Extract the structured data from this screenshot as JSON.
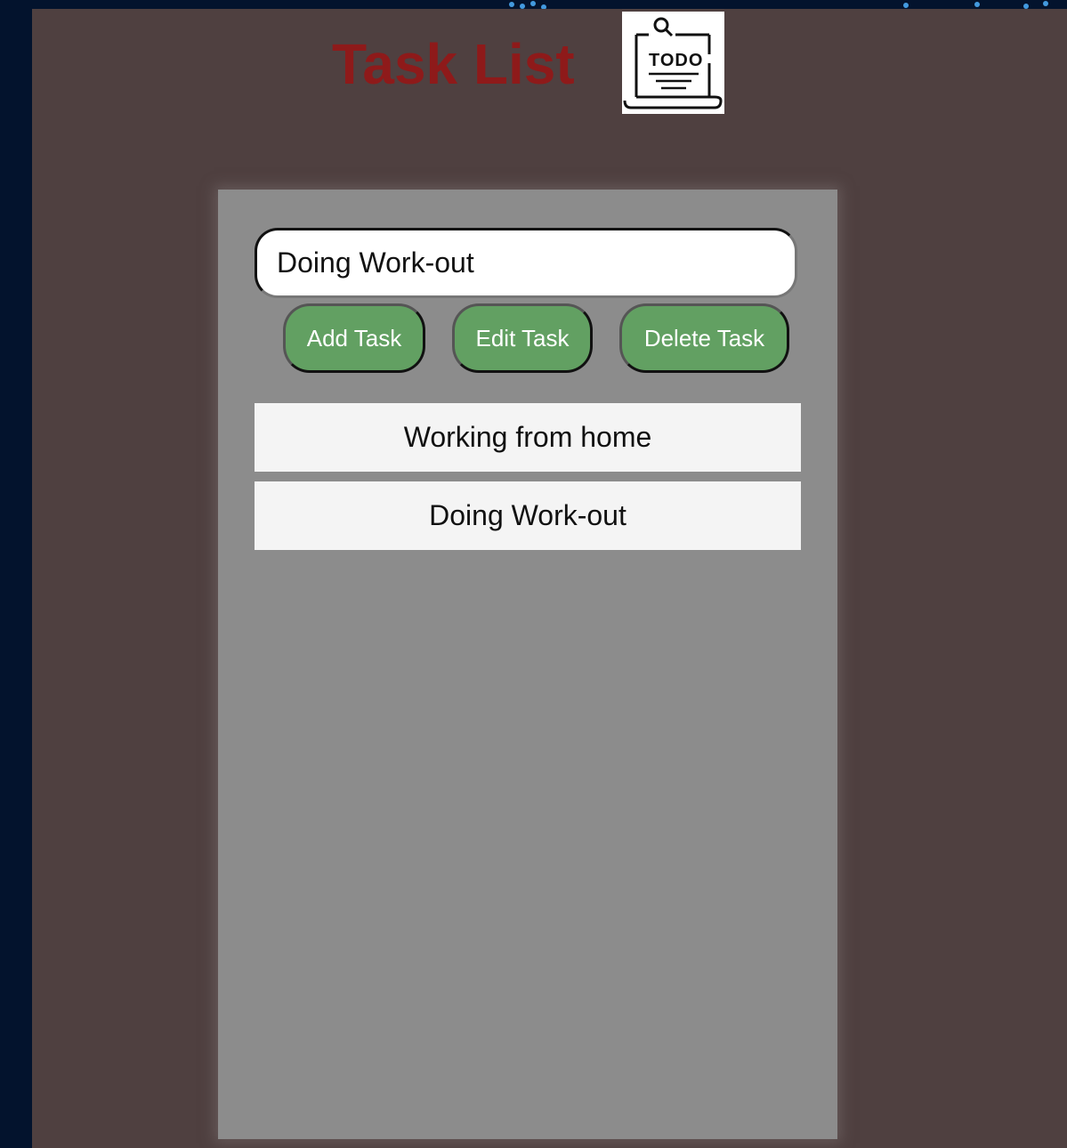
{
  "header": {
    "title": "Task List",
    "logo_text": "TODO"
  },
  "input": {
    "value": "Doing Work-out"
  },
  "buttons": {
    "add": "Add Task",
    "edit": "Edit Task",
    "delete": "Delete Task"
  },
  "tasks": [
    "Working from home",
    "Doing Work-out"
  ],
  "colors": {
    "background": "#4f4040",
    "title": "#8e1a1a",
    "card": "#8c8c8c",
    "button": "#62a062"
  }
}
